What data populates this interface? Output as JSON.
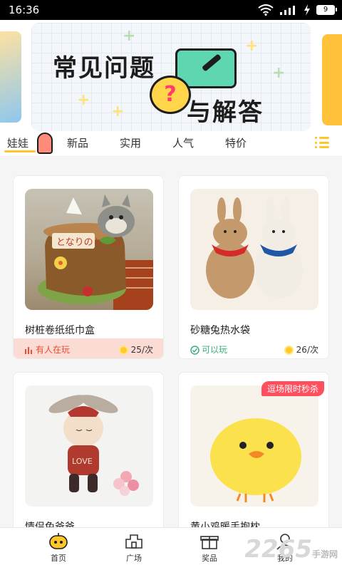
{
  "status_bar": {
    "time": "16:36",
    "battery": "9"
  },
  "banner": {
    "line1": "常见问题",
    "line2": "与解答",
    "badge": "?"
  },
  "tabs": [
    {
      "label": "娃娃",
      "active": true
    },
    {
      "label": "新品"
    },
    {
      "label": "实用"
    },
    {
      "label": "人气"
    },
    {
      "label": "特价"
    }
  ],
  "products": [
    {
      "name": "树桩卷纸纸巾盒",
      "status": "有人在玩",
      "status_kind": "playing",
      "price": "25/次"
    },
    {
      "name": "砂糖兔热水袋",
      "status": "可以玩",
      "status_kind": "free",
      "price": "26/次"
    },
    {
      "name": "情侣兔爸爸",
      "status": "",
      "price": ""
    },
    {
      "name": "黄小鸡暖手抱枕",
      "status": "",
      "price": "",
      "promo": "逗场限时秒杀"
    }
  ],
  "bottom_nav": [
    {
      "label": "首页",
      "icon": "robot-face-icon"
    },
    {
      "label": "广场",
      "icon": "plaza-icon"
    },
    {
      "label": "奖品",
      "icon": "gift-icon"
    },
    {
      "label": "我的",
      "icon": "profile-icon"
    }
  ],
  "watermark": {
    "brand": "2265",
    "sub": "手游网"
  },
  "colors": {
    "accent": "#ffc629",
    "playing": "#e94d36",
    "free": "#3ab07a",
    "promo": "#ff4f5e"
  }
}
